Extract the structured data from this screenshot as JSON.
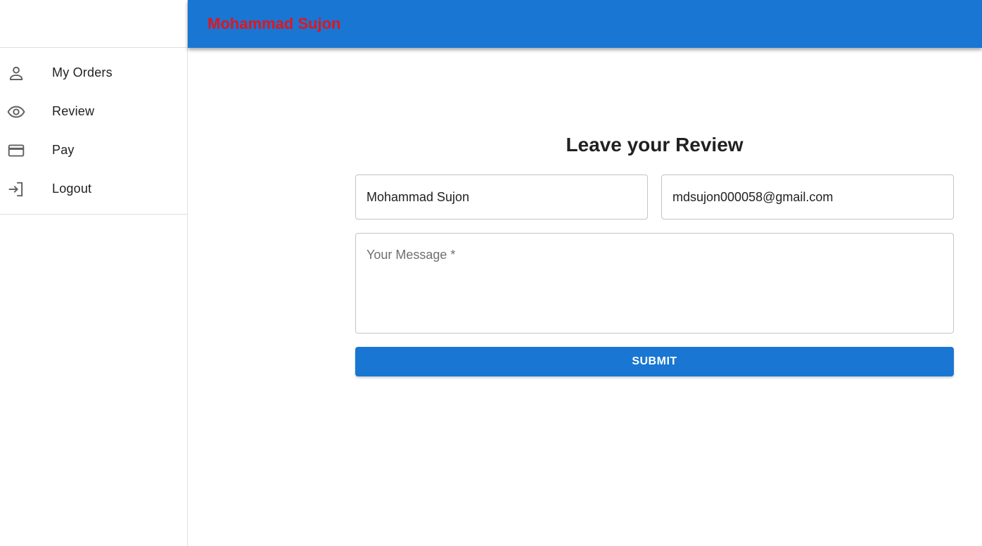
{
  "app": {
    "title": "Mohammad Sujon",
    "title_color": "#e5141c",
    "appbar_color": "#1976d2"
  },
  "sidebar": {
    "items": [
      {
        "label": "My Orders",
        "icon": "person-icon"
      },
      {
        "label": "Review",
        "icon": "eye-icon"
      },
      {
        "label": "Pay",
        "icon": "credit-card-icon"
      },
      {
        "label": "Logout",
        "icon": "login-icon"
      }
    ]
  },
  "form": {
    "title": "Leave your Review",
    "name_value": "Mohammad Sujon",
    "email_value": "mdsujon000058@gmail.com",
    "message_placeholder": "Your Message *",
    "submit_label": "SUBMIT"
  }
}
